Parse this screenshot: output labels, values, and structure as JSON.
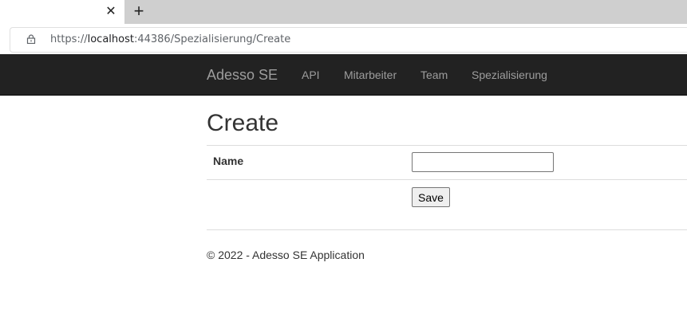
{
  "browser": {
    "tab_close_glyph": "✕",
    "new_tab_glyph": "+",
    "url_scheme": "https://",
    "url_host": "localhost",
    "url_rest": ":44386/Spezialisierung/Create"
  },
  "navbar": {
    "brand": "Adesso SE",
    "links": [
      "API",
      "Mitarbeiter",
      "Team",
      "Spezialisierung"
    ]
  },
  "page": {
    "title": "Create",
    "name_label": "Name",
    "name_value": "",
    "save_label": "Save"
  },
  "footer": {
    "text": "© 2022 - Adesso SE Application"
  },
  "colors": {
    "navbar_bg": "#222222",
    "nav_text": "#9d9d9d",
    "tabstrip_bg": "#cfcfcf"
  }
}
